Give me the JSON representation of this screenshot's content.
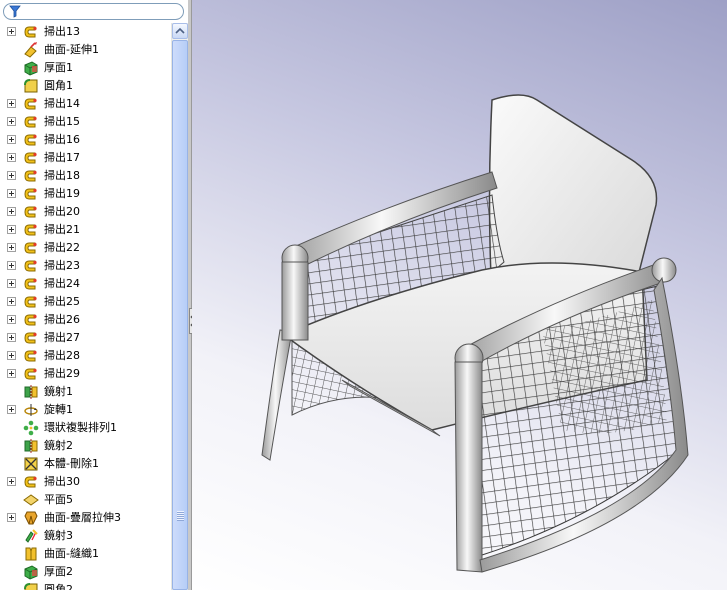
{
  "filter": {
    "icon": "filter-icon"
  },
  "tree": {
    "items": [
      {
        "label": "掃出13",
        "icon": "sweep-icon",
        "expandable": true
      },
      {
        "label": "曲面-延伸1",
        "icon": "surface-extend-icon",
        "expandable": false
      },
      {
        "label": "厚面1",
        "icon": "thicken-icon",
        "expandable": false
      },
      {
        "label": "圓角1",
        "icon": "fillet-icon",
        "expandable": false
      },
      {
        "label": "掃出14",
        "icon": "sweep-icon",
        "expandable": true
      },
      {
        "label": "掃出15",
        "icon": "sweep-icon",
        "expandable": true
      },
      {
        "label": "掃出16",
        "icon": "sweep-icon",
        "expandable": true
      },
      {
        "label": "掃出17",
        "icon": "sweep-icon",
        "expandable": true
      },
      {
        "label": "掃出18",
        "icon": "sweep-icon",
        "expandable": true
      },
      {
        "label": "掃出19",
        "icon": "sweep-icon",
        "expandable": true
      },
      {
        "label": "掃出20",
        "icon": "sweep-icon",
        "expandable": true
      },
      {
        "label": "掃出21",
        "icon": "sweep-icon",
        "expandable": true
      },
      {
        "label": "掃出22",
        "icon": "sweep-icon",
        "expandable": true
      },
      {
        "label": "掃出23",
        "icon": "sweep-icon",
        "expandable": true
      },
      {
        "label": "掃出24",
        "icon": "sweep-icon",
        "expandable": true
      },
      {
        "label": "掃出25",
        "icon": "sweep-icon",
        "expandable": true
      },
      {
        "label": "掃出26",
        "icon": "sweep-icon",
        "expandable": true
      },
      {
        "label": "掃出27",
        "icon": "sweep-icon",
        "expandable": true
      },
      {
        "label": "掃出28",
        "icon": "sweep-icon",
        "expandable": true
      },
      {
        "label": "掃出29",
        "icon": "sweep-icon",
        "expandable": true
      },
      {
        "label": "鏡射1",
        "icon": "mirror-icon",
        "expandable": false
      },
      {
        "label": "旋轉1",
        "icon": "revolve-icon",
        "expandable": true
      },
      {
        "label": "環狀複製排列1",
        "icon": "circular-pattern-icon",
        "expandable": false
      },
      {
        "label": "鏡射2",
        "icon": "mirror-icon",
        "expandable": false
      },
      {
        "label": "本體-刪除1",
        "icon": "delete-body-icon",
        "expandable": false
      },
      {
        "label": "掃出30",
        "icon": "sweep-icon",
        "expandable": true
      },
      {
        "label": "平面5",
        "icon": "plane-icon",
        "expandable": false
      },
      {
        "label": "曲面-疊層拉伸3",
        "icon": "surface-loft-icon",
        "expandable": true
      },
      {
        "label": "鏡射3",
        "icon": "mirror-body-icon",
        "expandable": false
      },
      {
        "label": "曲面-縫織1",
        "icon": "surface-knit-icon",
        "expandable": false
      },
      {
        "label": "厚面2",
        "icon": "thicken-icon",
        "expandable": false
      },
      {
        "label": "圓角2",
        "icon": "fillet-icon",
        "expandable": false
      }
    ]
  },
  "colors": {
    "sweep_yellow": "#f3c21a",
    "sweep_outline": "#8a6a00",
    "tree_text": "#000000",
    "viewport_top": "#9ea0c6",
    "viewport_bottom": "#ffffff",
    "scroll_thumb": "#c3d5f9"
  }
}
